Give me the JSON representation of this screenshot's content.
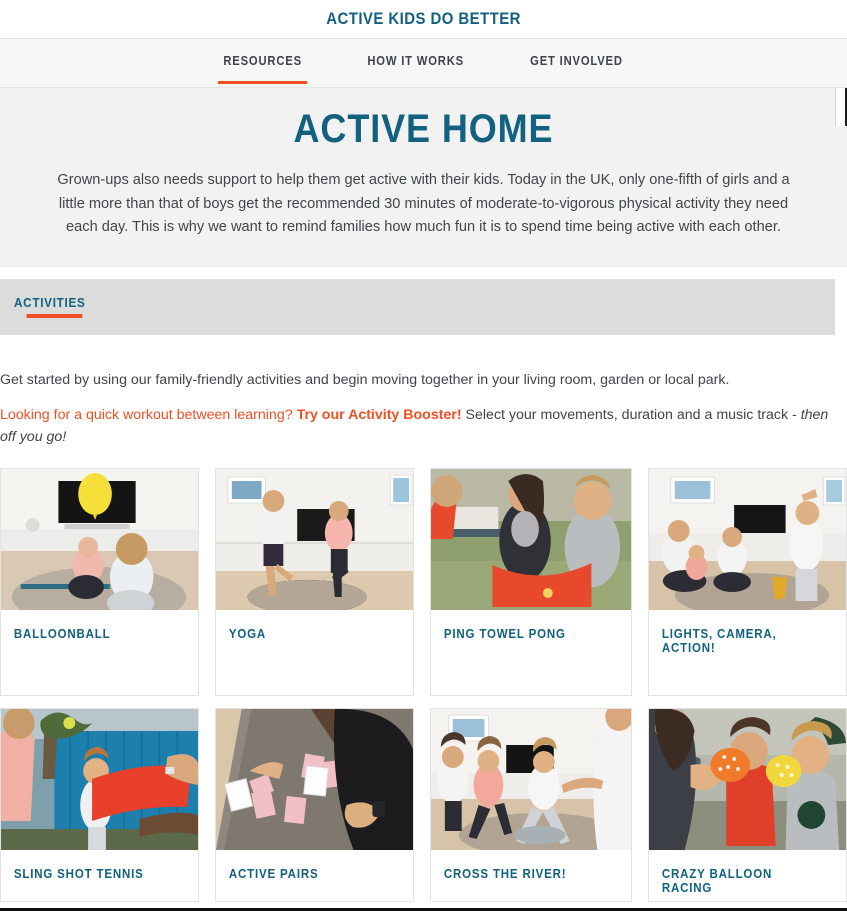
{
  "brand": {
    "title": "ACTIVE KIDS DO BETTER"
  },
  "nav": {
    "items": [
      {
        "label": "RESOURCES",
        "active": true
      },
      {
        "label": "HOW IT WORKS",
        "active": false
      },
      {
        "label": "GET INVOLVED",
        "active": false
      }
    ]
  },
  "hero": {
    "title": "ACTIVE HOME",
    "body": "Grown-ups also needs support to help them get active with their kids. Today in the UK, only one-fifth of girls and a little more than that of boys get the recommended 30 minutes of moderate-to-vigorous physical activity they need each day. This is why we want to remind families how much fun it is to spend time being active with each other."
  },
  "tabs": {
    "items": [
      {
        "label": "ACTIVITIES",
        "active": true
      }
    ]
  },
  "intro": {
    "line1": "Get started by using our family-friendly activities and begin moving together in your living room, garden or local park.",
    "line2_lead": "Looking for a quick workout between learning?",
    "line2_link": "Try our Activity Booster",
    "line2_bang": "!",
    "line2_mid": " Select your movements, duration and a music track - ",
    "line2_italic": "then off you go!"
  },
  "colors": {
    "brand_blue": "#11617f",
    "accent_orange": "#f04e23",
    "body_text": "#3f4549",
    "hero_bg": "#f2f2f2",
    "tab_bg": "#dcdcdc",
    "nav_bg": "#f7f7f7"
  },
  "activities": [
    {
      "label": "BALLOONBALL",
      "image": "kids-living-room-yellow-balloon-photo"
    },
    {
      "label": "YOGA",
      "image": "man-and-girl-tree-pose-photo"
    },
    {
      "label": "PING TOWEL PONG",
      "image": "family-outdoors-red-towel-ball-photo"
    },
    {
      "label": "LIGHTS, CAMERA, ACTION!",
      "image": "family-living-room-charades-photo"
    },
    {
      "label": "SLING SHOT TENNIS",
      "image": "boy-garden-blue-fence-red-towel-photo"
    },
    {
      "label": "ACTIVE PAIRS",
      "image": "girl-memory-cards-on-carpet-photo"
    },
    {
      "label": "CROSS THE RIVER!",
      "image": "family-living-room-stepping-stone-photo"
    },
    {
      "label": "CRAZY BALLOON RACING",
      "image": "kids-blowing-orange-yellow-balloons-photo"
    }
  ]
}
